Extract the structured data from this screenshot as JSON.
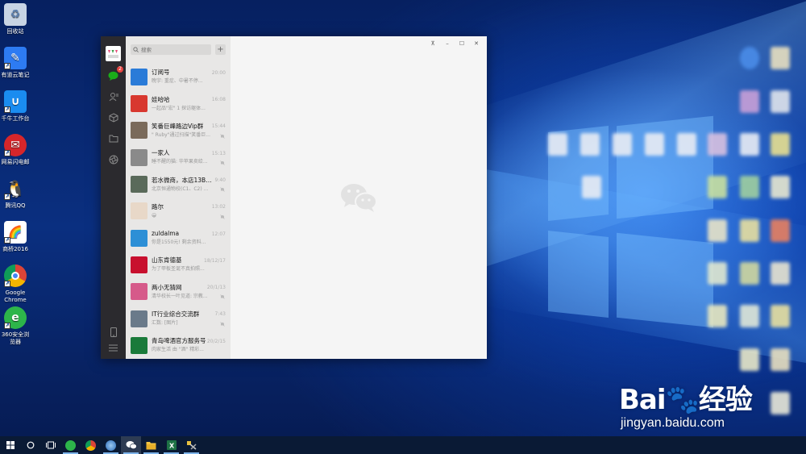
{
  "desktop": {
    "icons": [
      {
        "label": "回收站",
        "color": "#5b7fb0"
      },
      {
        "label": "有道云笔记",
        "color": "#2d7bf2"
      },
      {
        "label": "千牛工作台",
        "color": "#1a8cf0"
      },
      {
        "label": "网易闪电邮",
        "color": "#d6262b"
      },
      {
        "label": "腾讯QQ",
        "color": "#111111"
      },
      {
        "label": "商桥2016",
        "color": "#ffffff"
      },
      {
        "label": "Google Chrome",
        "color": "#4285f4"
      },
      {
        "label": "360安全浏览器",
        "color": "#2db54a"
      }
    ]
  },
  "wechat": {
    "search_placeholder": "搜索",
    "add_label": "+",
    "nav": {
      "chat_badge": "2"
    },
    "window_controls": {
      "pin": "⊼",
      "minimize": "–",
      "maximize": "☐",
      "close": "✕"
    },
    "chats": [
      {
        "name": "订阅号",
        "msg": "晚宇: 重症、中暑不停...",
        "time": "20:00",
        "color": "#2a7bd8",
        "muted": false
      },
      {
        "name": "娃哈哈",
        "msg": "一起品\"宏\" 1 探访躯体...",
        "time": "16:08",
        "color": "#d8382f",
        "muted": false
      },
      {
        "name": "笑番巨峰路边Vip群",
        "msg": "\" Ruby\"通过扫描\"笑番巨...",
        "time": "15:44",
        "color": "#7a6a5a",
        "muted": true
      },
      {
        "name": "一家人",
        "msg": "睡不醒的猫: 华苹果卖给...",
        "time": "15:13",
        "color": "#8a8a8a",
        "muted": true
      },
      {
        "name": "若水微商，本店13B69...",
        "msg": "北京恒通物校(C1、C2) ...",
        "time": "9:40",
        "color": "#5a6a5a",
        "muted": true
      },
      {
        "name": "路尔",
        "msg": "😀",
        "time": "13:02",
        "color": "#e8d8c8",
        "muted": true
      },
      {
        "name": "zuldalma",
        "msg": "你是1550元! 剩余资料...",
        "time": "12:07",
        "color": "#2d8fd6",
        "muted": false
      },
      {
        "name": "山东肯德基",
        "msg": "为了甲板圣诞不真拍照...",
        "time": "18/12/17",
        "color": "#c8102e",
        "muted": false
      },
      {
        "name": "两小无猜网",
        "msg": "清华校长一叶见道: 宗教...",
        "time": "20/1/13",
        "color": "#d65a8a",
        "muted": true
      },
      {
        "name": "IT行业综合交流群",
        "msg": "汇数: [图片]",
        "time": "7:43",
        "color": "#6a7a8a",
        "muted": true
      },
      {
        "name": "青岛啤酒官方服务号",
        "msg": "肉家生活 由 \"酒\" 精彩...",
        "time": "20/2/15",
        "color": "#1a7a3a",
        "muted": false
      }
    ]
  },
  "watermark": {
    "brand": "Bai🐾经验",
    "url": "jingyan.baidu.com"
  }
}
